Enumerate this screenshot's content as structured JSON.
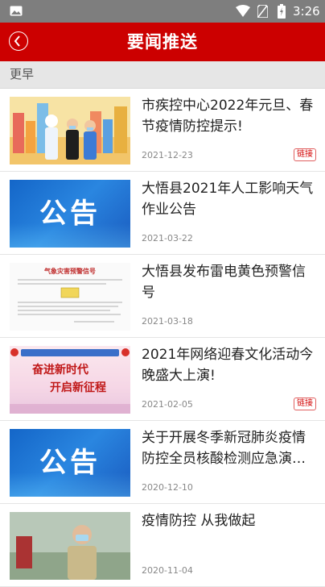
{
  "status_bar": {
    "time": "3:26",
    "icons": [
      "image-icon",
      "wifi-icon",
      "no-sim-icon",
      "battery-icon"
    ]
  },
  "header": {
    "title": "要闻推送",
    "back_icon": "back-arrow-icon",
    "bg_color": "#cc0000"
  },
  "section": {
    "label": "更早"
  },
  "news": [
    {
      "title": "市疾控中心2022年元旦、春节疫情防控提示!",
      "date": "2021-12-23",
      "badge": "链接",
      "thumb": "epidemic-illustration"
    },
    {
      "title": "大悟县2021年人工影响天气作业公告",
      "date": "2021-03-22",
      "badge": "",
      "thumb": "notice-banner",
      "thumb_text": "公告"
    },
    {
      "title": "大悟县发布雷电黄色预警信号",
      "date": "2021-03-18",
      "badge": "",
      "thumb": "warning-document",
      "thumb_text": "气象灾害预警信号"
    },
    {
      "title": "2021年网络迎春文化活动今晚盛大上演!",
      "date": "2021-02-05",
      "badge": "链接",
      "thumb": "spring-festival-poster",
      "thumb_lines": [
        "奋进新时代",
        "开启新征程"
      ]
    },
    {
      "title": "关于开展冬季新冠肺炎疫情防控全员核酸检测应急演练的通知",
      "date": "2020-12-10",
      "badge": "",
      "thumb": "notice-banner",
      "thumb_text": "公告"
    },
    {
      "title": "疫情防控 从我做起",
      "date": "2020-11-04",
      "badge": "",
      "thumb": "masked-person-photo"
    }
  ]
}
